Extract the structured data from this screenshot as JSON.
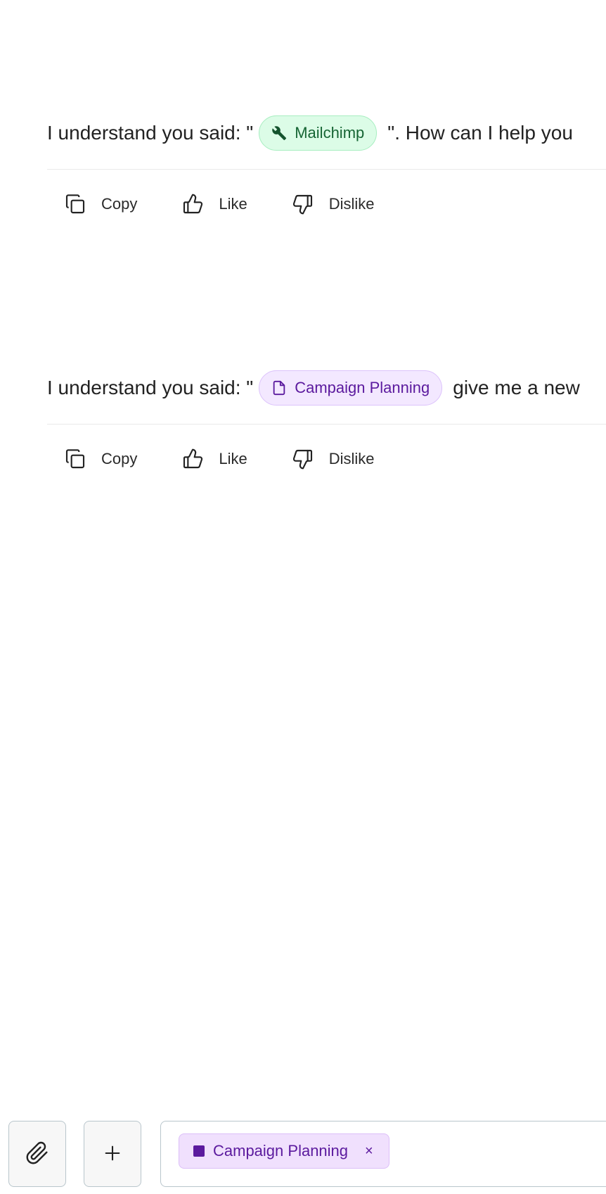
{
  "messages": [
    {
      "prefix": "I understand you said: \"",
      "chip": {
        "label": "Mailchimp",
        "icon": "wrench-icon",
        "color": "#166534",
        "background": "#dcfce7"
      },
      "suffix": "\". How can I help you"
    },
    {
      "prefix": "I understand you said: \"",
      "chip": {
        "label": "Campaign Planning",
        "icon": "document-icon",
        "color": "#5b1a9e",
        "background": "#f3e8ff"
      },
      "suffix": "give me a new"
    }
  ],
  "actions": {
    "copy_label": "Copy",
    "like_label": "Like",
    "dislike_label": "Dislike"
  },
  "composer": {
    "attach_icon": "paperclip-icon",
    "add_icon": "plus-icon",
    "context_chip": {
      "label": "Campaign Planning",
      "remove_glyph": "×",
      "color": "#5b1a9e"
    }
  }
}
